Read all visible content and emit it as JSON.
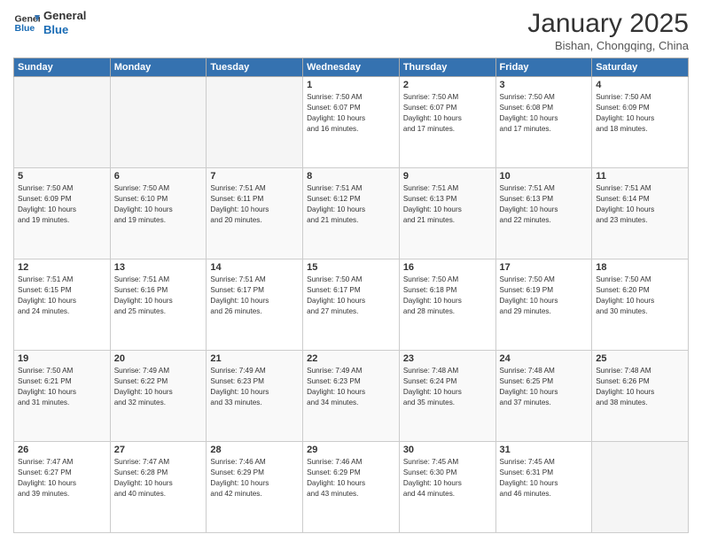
{
  "logo": {
    "line1": "General",
    "line2": "Blue"
  },
  "title": "January 2025",
  "subtitle": "Bishan, Chongqing, China",
  "days_header": [
    "Sunday",
    "Monday",
    "Tuesday",
    "Wednesday",
    "Thursday",
    "Friday",
    "Saturday"
  ],
  "weeks": [
    {
      "days": [
        {
          "num": "",
          "info": ""
        },
        {
          "num": "",
          "info": ""
        },
        {
          "num": "",
          "info": ""
        },
        {
          "num": "1",
          "info": "Sunrise: 7:50 AM\nSunset: 6:07 PM\nDaylight: 10 hours\nand 16 minutes."
        },
        {
          "num": "2",
          "info": "Sunrise: 7:50 AM\nSunset: 6:07 PM\nDaylight: 10 hours\nand 17 minutes."
        },
        {
          "num": "3",
          "info": "Sunrise: 7:50 AM\nSunset: 6:08 PM\nDaylight: 10 hours\nand 17 minutes."
        },
        {
          "num": "4",
          "info": "Sunrise: 7:50 AM\nSunset: 6:09 PM\nDaylight: 10 hours\nand 18 minutes."
        }
      ]
    },
    {
      "days": [
        {
          "num": "5",
          "info": "Sunrise: 7:50 AM\nSunset: 6:09 PM\nDaylight: 10 hours\nand 19 minutes."
        },
        {
          "num": "6",
          "info": "Sunrise: 7:50 AM\nSunset: 6:10 PM\nDaylight: 10 hours\nand 19 minutes."
        },
        {
          "num": "7",
          "info": "Sunrise: 7:51 AM\nSunset: 6:11 PM\nDaylight: 10 hours\nand 20 minutes."
        },
        {
          "num": "8",
          "info": "Sunrise: 7:51 AM\nSunset: 6:12 PM\nDaylight: 10 hours\nand 21 minutes."
        },
        {
          "num": "9",
          "info": "Sunrise: 7:51 AM\nSunset: 6:13 PM\nDaylight: 10 hours\nand 21 minutes."
        },
        {
          "num": "10",
          "info": "Sunrise: 7:51 AM\nSunset: 6:13 PM\nDaylight: 10 hours\nand 22 minutes."
        },
        {
          "num": "11",
          "info": "Sunrise: 7:51 AM\nSunset: 6:14 PM\nDaylight: 10 hours\nand 23 minutes."
        }
      ]
    },
    {
      "days": [
        {
          "num": "12",
          "info": "Sunrise: 7:51 AM\nSunset: 6:15 PM\nDaylight: 10 hours\nand 24 minutes."
        },
        {
          "num": "13",
          "info": "Sunrise: 7:51 AM\nSunset: 6:16 PM\nDaylight: 10 hours\nand 25 minutes."
        },
        {
          "num": "14",
          "info": "Sunrise: 7:51 AM\nSunset: 6:17 PM\nDaylight: 10 hours\nand 26 minutes."
        },
        {
          "num": "15",
          "info": "Sunrise: 7:50 AM\nSunset: 6:17 PM\nDaylight: 10 hours\nand 27 minutes."
        },
        {
          "num": "16",
          "info": "Sunrise: 7:50 AM\nSunset: 6:18 PM\nDaylight: 10 hours\nand 28 minutes."
        },
        {
          "num": "17",
          "info": "Sunrise: 7:50 AM\nSunset: 6:19 PM\nDaylight: 10 hours\nand 29 minutes."
        },
        {
          "num": "18",
          "info": "Sunrise: 7:50 AM\nSunset: 6:20 PM\nDaylight: 10 hours\nand 30 minutes."
        }
      ]
    },
    {
      "days": [
        {
          "num": "19",
          "info": "Sunrise: 7:50 AM\nSunset: 6:21 PM\nDaylight: 10 hours\nand 31 minutes."
        },
        {
          "num": "20",
          "info": "Sunrise: 7:49 AM\nSunset: 6:22 PM\nDaylight: 10 hours\nand 32 minutes."
        },
        {
          "num": "21",
          "info": "Sunrise: 7:49 AM\nSunset: 6:23 PM\nDaylight: 10 hours\nand 33 minutes."
        },
        {
          "num": "22",
          "info": "Sunrise: 7:49 AM\nSunset: 6:23 PM\nDaylight: 10 hours\nand 34 minutes."
        },
        {
          "num": "23",
          "info": "Sunrise: 7:48 AM\nSunset: 6:24 PM\nDaylight: 10 hours\nand 35 minutes."
        },
        {
          "num": "24",
          "info": "Sunrise: 7:48 AM\nSunset: 6:25 PM\nDaylight: 10 hours\nand 37 minutes."
        },
        {
          "num": "25",
          "info": "Sunrise: 7:48 AM\nSunset: 6:26 PM\nDaylight: 10 hours\nand 38 minutes."
        }
      ]
    },
    {
      "days": [
        {
          "num": "26",
          "info": "Sunrise: 7:47 AM\nSunset: 6:27 PM\nDaylight: 10 hours\nand 39 minutes."
        },
        {
          "num": "27",
          "info": "Sunrise: 7:47 AM\nSunset: 6:28 PM\nDaylight: 10 hours\nand 40 minutes."
        },
        {
          "num": "28",
          "info": "Sunrise: 7:46 AM\nSunset: 6:29 PM\nDaylight: 10 hours\nand 42 minutes."
        },
        {
          "num": "29",
          "info": "Sunrise: 7:46 AM\nSunset: 6:29 PM\nDaylight: 10 hours\nand 43 minutes."
        },
        {
          "num": "30",
          "info": "Sunrise: 7:45 AM\nSunset: 6:30 PM\nDaylight: 10 hours\nand 44 minutes."
        },
        {
          "num": "31",
          "info": "Sunrise: 7:45 AM\nSunset: 6:31 PM\nDaylight: 10 hours\nand 46 minutes."
        },
        {
          "num": "",
          "info": ""
        }
      ]
    }
  ]
}
